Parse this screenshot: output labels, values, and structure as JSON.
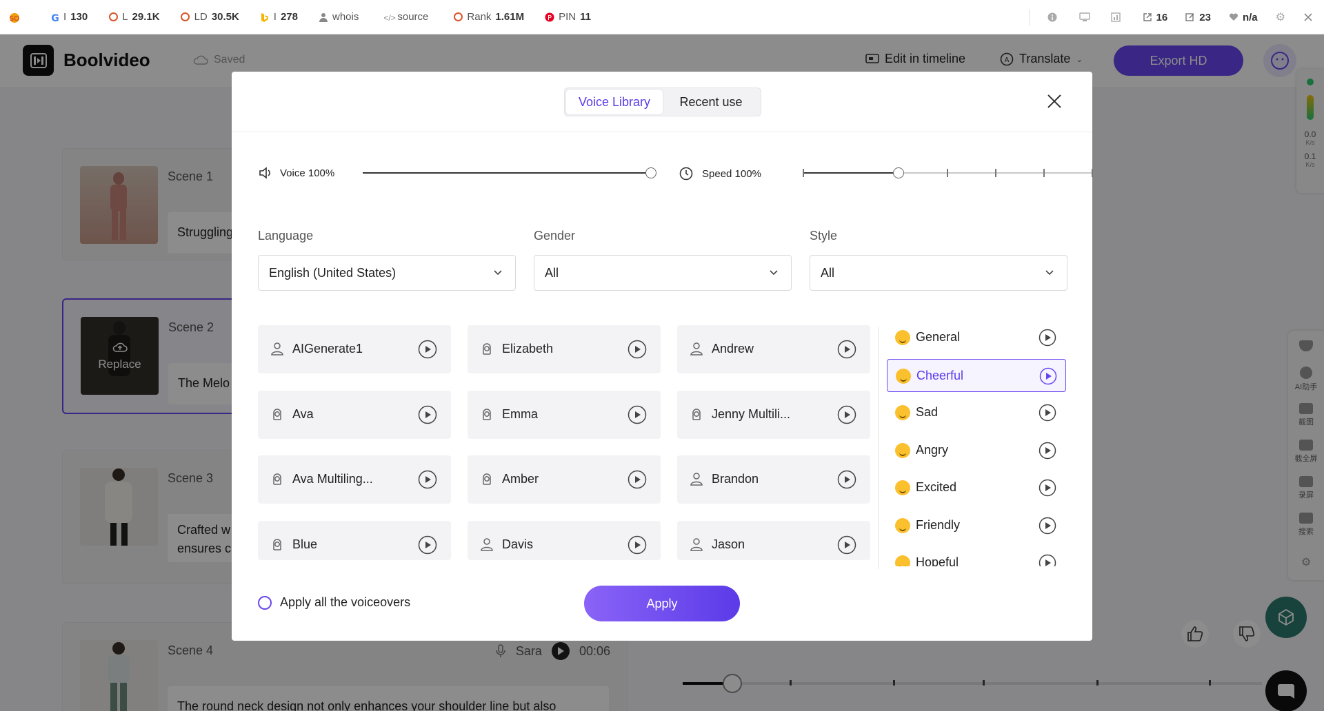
{
  "extension_bar": {
    "items": [
      {
        "icon": "google-icon",
        "label": "I",
        "value": "130"
      },
      {
        "icon": "ring-icon",
        "label": "L",
        "value": "29.1K"
      },
      {
        "icon": "ring-icon",
        "label": "LD",
        "value": "30.5K"
      },
      {
        "icon": "bing-icon",
        "label": "I",
        "value": "278"
      },
      {
        "icon": "person-icon",
        "label": "whois",
        "value": ""
      },
      {
        "icon": "code-icon",
        "label": "source",
        "value": ""
      },
      {
        "icon": "ring-icon",
        "label": "Rank",
        "value": "1.61M"
      },
      {
        "icon": "pinterest-icon",
        "label": "PIN",
        "value": "11"
      }
    ],
    "right_items": [
      {
        "icon": "info-icon",
        "value": ""
      },
      {
        "icon": "monitor-icon",
        "value": ""
      },
      {
        "icon": "chart-icon",
        "value": ""
      },
      {
        "icon": "external-link-icon",
        "value": "16"
      },
      {
        "icon": "edit-icon",
        "value": "23"
      },
      {
        "icon": "heart-icon",
        "value": "n/a"
      }
    ]
  },
  "app": {
    "name": "Boolvideo",
    "saved_label": "Saved",
    "edit_in_timeline": "Edit in timeline",
    "translate": "Translate",
    "export": "Export HD"
  },
  "scenes": [
    {
      "label": "Scene 1",
      "text": "Struggling"
    },
    {
      "label": "Scene 2",
      "text": "The Melo",
      "replace_label": "Replace"
    },
    {
      "label": "Scene 3",
      "text": "Crafted w\nensures c"
    },
    {
      "label": "Scene 4",
      "text": "The round neck design not only enhances your shoulder line but also",
      "voice": "Sara",
      "duration": "00:06"
    }
  ],
  "side_tools": {
    "meter_top": "0.0",
    "meter_top_unit": "K/s",
    "meter_bottom": "0.1",
    "meter_bottom_unit": "K/s",
    "tools": [
      "AI助手",
      "截图",
      "截全屏",
      "录屏",
      "搜索"
    ]
  },
  "modal": {
    "tabs": [
      "Voice Library",
      "Recent use"
    ],
    "active_tab": 0,
    "voice_slider": {
      "label": "Voice 100%",
      "value": 1.0
    },
    "speed_slider": {
      "label": "Speed 100%",
      "value": 0.33
    },
    "filters": {
      "language": {
        "label": "Language",
        "value": "English (United States)"
      },
      "gender": {
        "label": "Gender",
        "value": "All"
      },
      "style": {
        "label": "Style",
        "value": "All"
      }
    },
    "voices": [
      {
        "name": "AIGenerate1",
        "gender": "male"
      },
      {
        "name": "Elizabeth",
        "gender": "female"
      },
      {
        "name": "Andrew",
        "gender": "male"
      },
      {
        "name": "Ava",
        "gender": "female"
      },
      {
        "name": "Emma",
        "gender": "female"
      },
      {
        "name": "Jenny Multili...",
        "gender": "female"
      },
      {
        "name": "Ava Multiling...",
        "gender": "female"
      },
      {
        "name": "Amber",
        "gender": "female"
      },
      {
        "name": "Brandon",
        "gender": "male"
      },
      {
        "name": "Blue",
        "gender": "female"
      },
      {
        "name": "Davis",
        "gender": "male"
      },
      {
        "name": "Jason",
        "gender": "male"
      }
    ],
    "styles": [
      "General",
      "Cheerful",
      "Sad",
      "Angry",
      "Excited",
      "Friendly",
      "Hopeful"
    ],
    "active_style": 1,
    "apply_all_label": "Apply all the voiceovers",
    "apply_label": "Apply"
  },
  "colors": {
    "accent": "#6b46f0",
    "accent_text": "#5b3be8",
    "overlay": "rgba(0,0,0,0.45)"
  }
}
